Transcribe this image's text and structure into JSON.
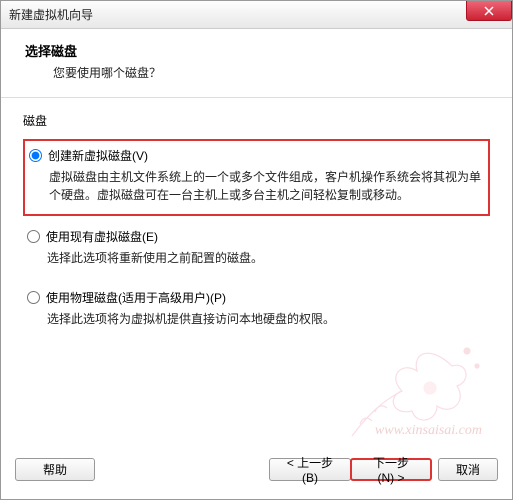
{
  "titlebar": {
    "title": "新建虚拟机向导"
  },
  "header": {
    "title": "选择磁盘",
    "subtitle": "您要使用哪个磁盘？"
  },
  "section_label": "磁盘",
  "options": [
    {
      "label": "创建新虚拟磁盘(V)",
      "desc": "虚拟磁盘由主机文件系统上的一个或多个文件组成，客户机操作系统会将其视为单个硬盘。虚拟磁盘可在一台主机上或多台主机之间轻松复制或移动。",
      "checked": true
    },
    {
      "label": "使用现有虚拟磁盘(E)",
      "desc": "选择此选项将重新使用之前配置的磁盘。",
      "checked": false
    },
    {
      "label": "使用物理磁盘(适用于高级用户)(P)",
      "desc": "选择此选项将为虚拟机提供直接访问本地硬盘的权限。",
      "checked": false
    }
  ],
  "footer": {
    "help": "帮助",
    "back": "< 上一步(B)",
    "next": "下一步(N) >",
    "cancel": "取消"
  },
  "watermark": "www.xinsaisai.com"
}
